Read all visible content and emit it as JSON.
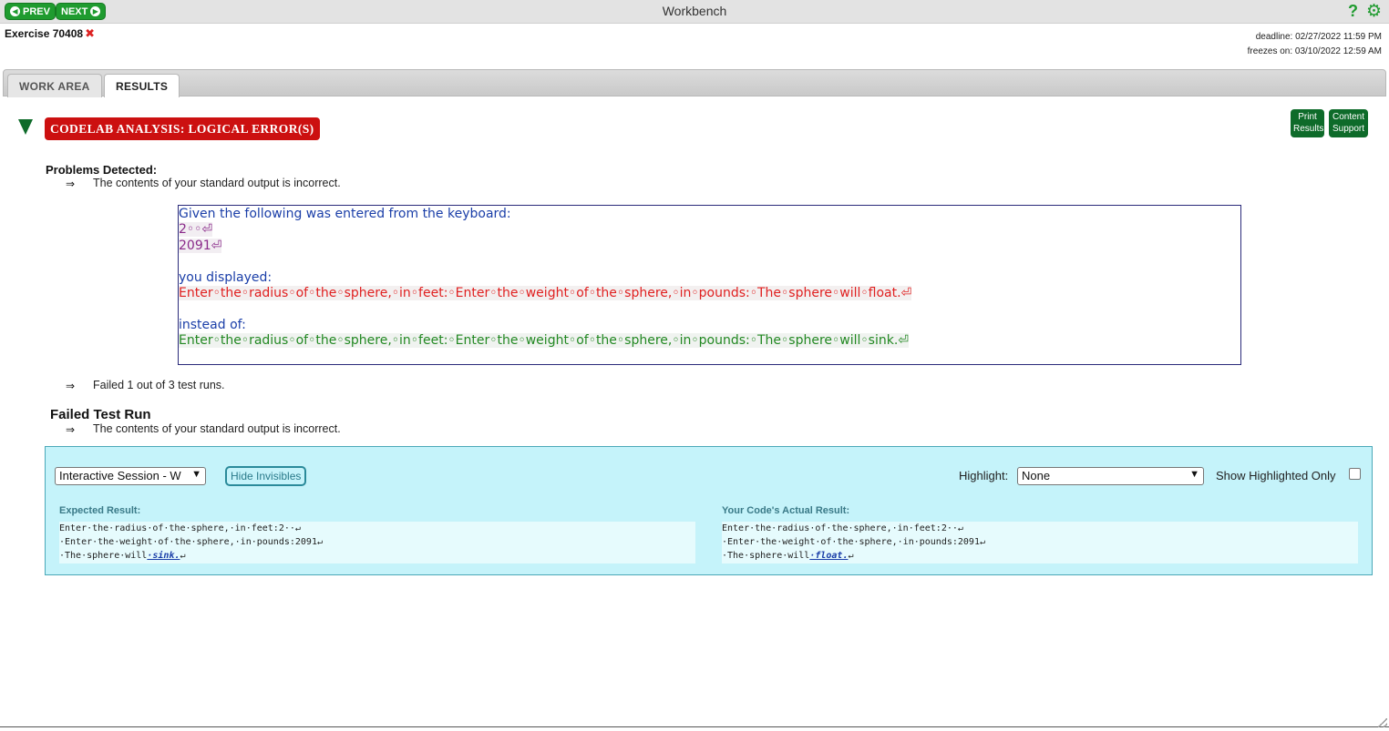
{
  "topbar": {
    "prev_label": "PREV",
    "next_label": "NEXT",
    "app_title": "Workbench",
    "help_icon": "help-icon",
    "settings_icon": "gear-icon",
    "accent_color": "#1f9b2f"
  },
  "exercise": {
    "title": "Exercise 70408",
    "status_icon": "close-icon",
    "deadline": "deadline: 02/27/2022 11:59 PM",
    "freezes": "freezes on: 03/10/2022 12:59 AM"
  },
  "tabs": {
    "work_area": "WORK AREA",
    "results": "RESULTS",
    "active": "RESULTS"
  },
  "analysis": {
    "banner": "CODELAB ANALYSIS: LOGICAL ERROR(S)",
    "print_results_line1": "Print",
    "print_results_line2": "Results",
    "content_support_line1": "Content",
    "content_support_line2": "Support",
    "banner_color": "#cc1010"
  },
  "problems": {
    "title": "Problems Detected:",
    "arrow": "⇒",
    "item1": "The contents of your standard output is incorrect.",
    "item2": "Failed 1 out of 3 test runs."
  },
  "diff": {
    "given_label": "Given the following was entered from the keyboard:",
    "input_line1": "2◦◦⏎",
    "input_line2": "2091⏎",
    "displayed_label": "you displayed:",
    "displayed_text": "Enter◦the◦radius◦of◦the◦sphere,◦in◦feet:◦Enter◦the◦weight◦of◦the◦sphere,◦in◦pounds:◦The◦sphere◦will◦float.⏎",
    "instead_label": "instead of:",
    "expected_text": "Enter◦the◦radius◦of◦the◦sphere,◦in◦feet:◦Enter◦the◦weight◦of◦the◦sphere,◦in◦pounds:◦The◦sphere◦will◦sink.⏎"
  },
  "failed_run": {
    "title": "Failed Test Run",
    "arrow": "⇒",
    "message": "The contents of your standard output is incorrect."
  },
  "session": {
    "select_value": "Interactive Session - W",
    "hide_invisibles": "Hide Invisibles",
    "highlight_label": "Highlight:",
    "highlight_value": "None",
    "show_highlighted_only": "Show Highlighted Only",
    "expected_head": "Expected Result:",
    "actual_head": "Your Code's Actual Result:",
    "expected_lines": {
      "l1": "Enter·the·radius·of·the·sphere,·in·feet:2··↵",
      "l2": "·Enter·the·weight·of·the·sphere,·in·pounds:2091↵",
      "l3_pre": "·The·sphere·will",
      "l3_hi": "·sink.",
      "l3_post": "↵"
    },
    "actual_lines": {
      "l1": "Enter·the·radius·of·the·sphere,·in·feet:2··↵",
      "l2": "·Enter·the·weight·of·the·sphere,·in·pounds:2091↵",
      "l3_pre": "·The·sphere·will",
      "l3_hi": "·float.",
      "l3_post": "↵"
    },
    "panel_color": "#c5f3fa"
  }
}
